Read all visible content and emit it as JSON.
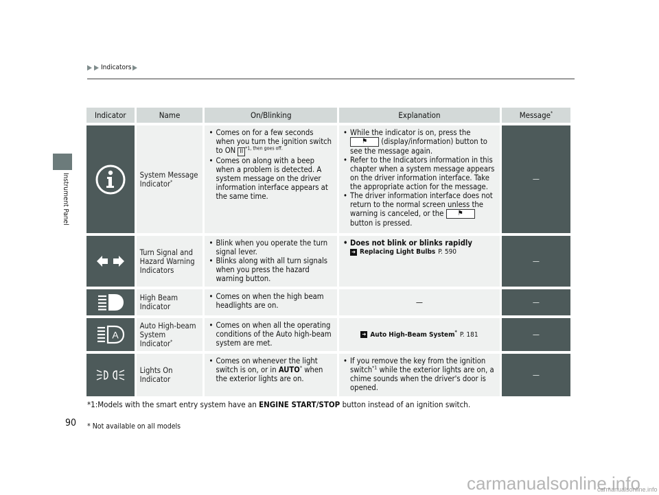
{
  "header": {
    "breadcrumb": "Indicators",
    "side_label": "Instrument Panel",
    "page_number": "90"
  },
  "table": {
    "columns": [
      "Indicator",
      "Name",
      "On/Blinking",
      "Explanation",
      "Message"
    ],
    "message_note_marker": "*",
    "rows": [
      {
        "icon": "info-circle-icon",
        "name": "System Message Indicator",
        "name_marker": "*",
        "on_blinking": [
          "Comes on for a few seconds when you turn the ignition switch to ON",
          "II",
          "*1, then goes off.",
          "Comes on along with a beep when a problem is detected. A system message on the driver information interface appears at the same time."
        ],
        "explanation": [
          "While the indicator is on, press the",
          "(display/information) button to see the message again.",
          "Refer to the Indicators information in this chapter when a system message appears on the driver information interface. Take the appropriate action for the message.",
          "The driver information interface does not return to the normal screen unless the warning is canceled, or the",
          "button is pressed."
        ],
        "message": "—"
      },
      {
        "icon": "turn-signal-arrows-icon",
        "name": "Turn Signal and Hazard Warning Indicators",
        "on_blinking": [
          "Blink when you operate the turn signal lever.",
          "Blinks along with all turn signals when you press the hazard warning button."
        ],
        "explanation": {
          "bullet": "Does not blink or blinks rapidly",
          "ref_title": "Replacing Light Bulbs",
          "ref_page": "P. 590"
        },
        "message": "—"
      },
      {
        "icon": "high-beam-icon",
        "name": "High Beam Indicator",
        "on_blinking": [
          "Comes on when the high beam headlights are on."
        ],
        "explanation": "—",
        "message": "—"
      },
      {
        "icon": "auto-high-beam-icon",
        "name": "Auto High-beam System Indicator",
        "name_marker": "*",
        "on_blinking": [
          "Comes on when all the operating conditions of the Auto high-beam system are met."
        ],
        "explanation": {
          "ref_title": "Auto High-Beam System",
          "ref_marker": "*",
          "ref_page": "P. 181"
        },
        "message": "—"
      },
      {
        "icon": "lights-on-icon",
        "name": "Lights On Indicator",
        "on_blinking": [
          "Comes on whenever the light switch is on, or in",
          "AUTO",
          "when the exterior lights are on."
        ],
        "explanation": [
          "If you remove the key from the ignition switch",
          "*1",
          "while the exterior lights are on, a chime sounds when the driver's door is opened."
        ],
        "message": "—"
      }
    ]
  },
  "footnotes": {
    "note1_prefix": "*1:Models with the smart entry system have an ",
    "note1_bold": "ENGINE START/STOP",
    "note1_suffix": " button instead of an ignition switch.",
    "availability": "* Not available on all models"
  },
  "watermark": {
    "large": "carmanualsonline.info",
    "small": "carmanualsonline.info"
  },
  "colors": {
    "icon_cell": "#4d5a5a",
    "header_cell": "#d3d9d8",
    "body_cell": "#eff1f0",
    "side_tab": "#6c7b7b"
  }
}
